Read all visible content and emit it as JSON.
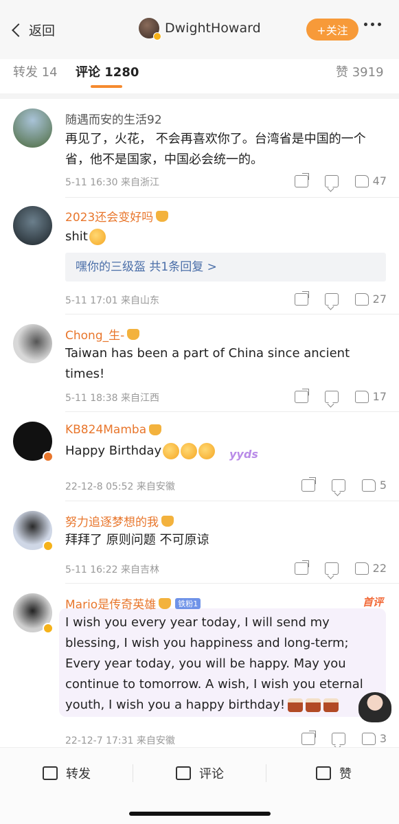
{
  "header": {
    "back_label": "返回",
    "account_name": "DwightHoward",
    "follow_label": "+关注"
  },
  "tabs": {
    "repost": "转发 14",
    "comments": "评论 1280",
    "likes": "赞 3919"
  },
  "comments": [
    {
      "user": "随遇而安的生活92",
      "text": "再见了，火花， 不会再喜欢你了。台湾省是中国的一个省，他不是国家，中国必会统一的。",
      "time": "5-11 16:30",
      "location": "来自浙江",
      "likes": "47"
    },
    {
      "user": "2023还会变好吗",
      "text": "shit",
      "reply": "嘿你的三级盔  共1条回复 >",
      "time": "5-11 17:01",
      "location": "来自山东",
      "likes": "27"
    },
    {
      "user": "Chong_生-",
      "text": "Taiwan has been a part of China since ancient times!",
      "time": "5-11 18:38",
      "location": "来自江西",
      "likes": "17"
    },
    {
      "user": "KB824Mamba",
      "text": "Happy Birthday",
      "sticker": "yyds",
      "time": "22-12-8 05:52",
      "location": "来自安徽",
      "likes": "5"
    },
    {
      "user": "努力追逐梦想的我",
      "text": "拜拜了 原则问题 不可原谅",
      "time": "5-11 16:22",
      "location": "来自吉林",
      "likes": "22"
    },
    {
      "user": "Mario是传奇英雄",
      "fan_badge": "铁粉1",
      "hot_label": "首评",
      "text": "I wish you every year today, I will send my blessing, I wish you happiness and long-term; Every year today, you will be happy. May you continue to tomorrow. A wish, I wish you eternal youth, I wish you a happy birthday!",
      "time": "22-12-7 17:31",
      "location": "来自安徽",
      "likes": "3"
    }
  ],
  "bottom_bar": {
    "repost": "转发",
    "comment": "评论",
    "like": "赞"
  },
  "colors": {
    "accent": "#f58a2f",
    "username_vip": "#e8762c",
    "link": "#4a6ea8"
  }
}
